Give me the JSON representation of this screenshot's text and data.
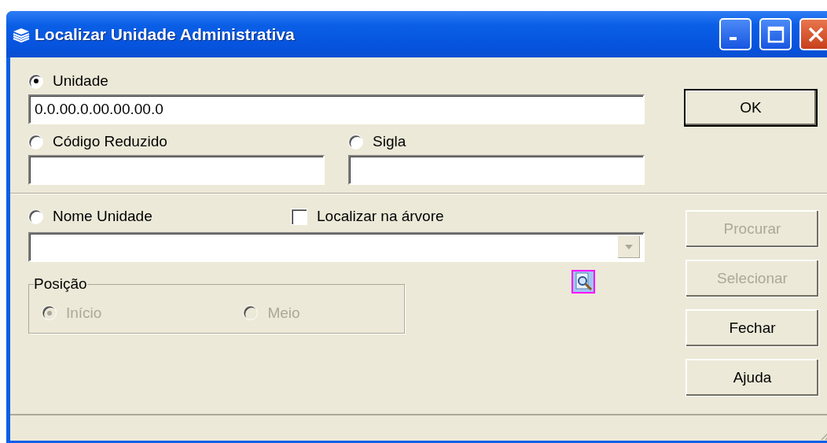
{
  "window": {
    "title": "Localizar Unidade Administrativa"
  },
  "unidade": {
    "label": "Unidade",
    "selected": true,
    "value": "0.0.00.0.00.00.00.0"
  },
  "codigo_reduzido": {
    "label": "Código Reduzido",
    "selected": false
  },
  "sigla": {
    "label": "Sigla",
    "selected": false
  },
  "nome_unidade": {
    "label": "Nome Unidade",
    "selected": false
  },
  "localizar_na_arvore": {
    "label": "Localizar na árvore",
    "checked": false
  },
  "posicao": {
    "title": "Posição",
    "disabled": true,
    "options": [
      {
        "label": "Início",
        "selected": true
      },
      {
        "label": "Meio",
        "selected": false
      }
    ]
  },
  "buttons": [
    {
      "label": "OK",
      "default": true,
      "disabled": false
    },
    {
      "label": "Procurar",
      "default": false,
      "disabled": true
    },
    {
      "label": "Selecionar",
      "default": false,
      "disabled": true
    },
    {
      "label": "Fechar",
      "default": false,
      "disabled": false
    },
    {
      "label": "Ajuda",
      "default": false,
      "disabled": false
    }
  ]
}
